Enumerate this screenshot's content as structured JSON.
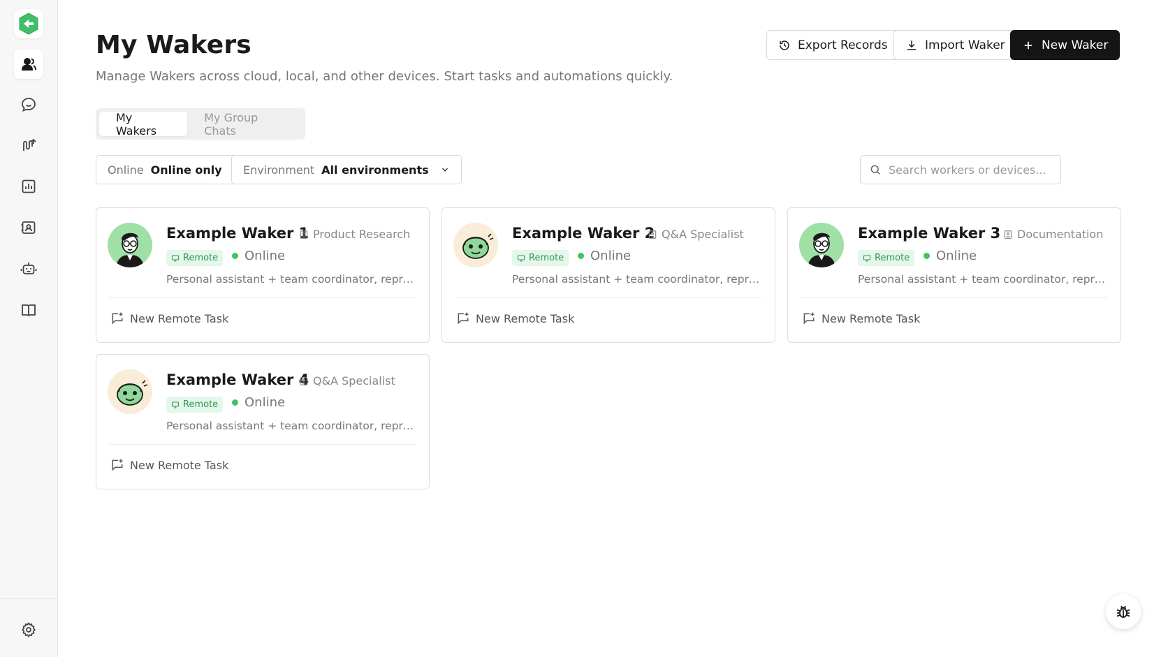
{
  "page": {
    "title": "My Wakers",
    "subtitle": "Manage Wakers across cloud, local, and other devices. Start tasks and automations quickly."
  },
  "toolbar": {
    "export_label": "Export Records",
    "import_label": "Import Waker",
    "new_label": "New Waker"
  },
  "tabs": [
    {
      "label": "My Wakers",
      "active": true
    },
    {
      "label": "My Group Chats",
      "active": false
    }
  ],
  "filters": {
    "online": {
      "label": "Online",
      "value": "Online only"
    },
    "environment": {
      "label": "Environment",
      "value": "All environments"
    }
  },
  "search": {
    "placeholder": "Search workers or devices..."
  },
  "sidebar": {
    "items": [
      {
        "icon": "users-icon",
        "active": true
      },
      {
        "icon": "chat-icon",
        "active": false
      },
      {
        "icon": "workflow-icon",
        "active": false
      },
      {
        "icon": "chart-icon",
        "active": false
      },
      {
        "icon": "contacts-icon",
        "active": false
      },
      {
        "icon": "robot-icon",
        "active": false
      },
      {
        "icon": "book-icon",
        "active": false
      }
    ],
    "settings_icon": "gear-icon"
  },
  "cards": [
    {
      "name": "Example Waker 1",
      "role": "Product Research",
      "badge": "Remote",
      "status": "Online",
      "description": "Personal assistant + team coordinator, representing the user",
      "action": "New Remote Task",
      "avatar": "person"
    },
    {
      "name": "Example Waker 2",
      "role": "Q&A Specialist",
      "badge": "Remote",
      "status": "Online",
      "description": "Personal assistant + team coordinator, representing the user",
      "action": "New Remote Task",
      "avatar": "bot"
    },
    {
      "name": "Example Waker 3",
      "role": "Documentation",
      "badge": "Remote",
      "status": "Online",
      "description": "Personal assistant + team coordinator, representing the user",
      "action": "New Remote Task",
      "avatar": "person"
    },
    {
      "name": "Example Waker 4",
      "role": "Q&A Specialist",
      "badge": "Remote",
      "status": "Online",
      "description": "Personal assistant + team coordinator, representing the user",
      "action": "New Remote Task",
      "avatar": "bot"
    }
  ],
  "colors": {
    "accent_green": "#41c265",
    "primary_button": "#151515",
    "badge_bg": "#e5f6ea",
    "badge_text": "#2f9a55"
  }
}
